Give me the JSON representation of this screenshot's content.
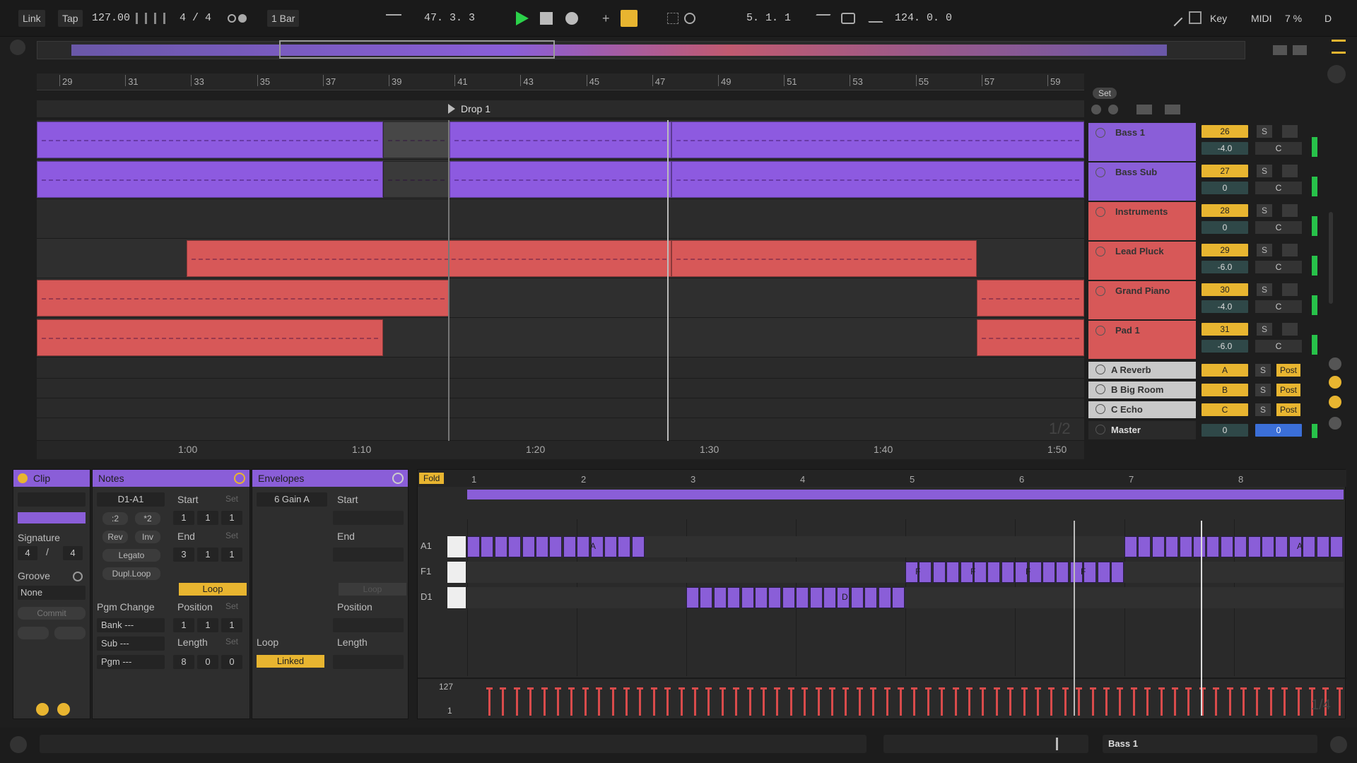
{
  "transport": {
    "link": "Link",
    "tap": "Tap",
    "tempo": "127.00",
    "signature_num": "4",
    "signature_sep": "/",
    "signature_den": "4",
    "quantize": "1 Bar",
    "position": "47.  3.  3",
    "loop_start": "5.  1.  1",
    "loop_length": "124.  0.  0",
    "key": "Key",
    "midi": "MIDI",
    "cpu": "7 %",
    "disk": "D"
  },
  "arrangement": {
    "bars": [
      "29",
      "31",
      "33",
      "35",
      "37",
      "39",
      "41",
      "43",
      "45",
      "47",
      "49",
      "51",
      "53",
      "55",
      "57",
      "59"
    ],
    "locator": "Drop 1",
    "times": [
      "1:00",
      "1:10",
      "1:20",
      "1:30",
      "1:40",
      "1:50"
    ],
    "page_indicator": "1/2",
    "set_label": "Set"
  },
  "tracks": [
    {
      "name": "Bass 1",
      "num": "26",
      "vol": "-4.0",
      "pan": "C",
      "color": "#8a5ed8",
      "solo": "S"
    },
    {
      "name": "Bass Sub",
      "num": "27",
      "vol": "0",
      "pan": "C",
      "color": "#8a5ed8",
      "solo": "S"
    },
    {
      "name": "Instruments",
      "num": "28",
      "vol": "0",
      "pan": "C",
      "color": "#d75858",
      "solo": "S"
    },
    {
      "name": "Lead Pluck",
      "num": "29",
      "vol": "-6.0",
      "pan": "C",
      "color": "#d75858",
      "solo": "S"
    },
    {
      "name": "Grand Piano",
      "num": "30",
      "vol": "-4.0",
      "pan": "C",
      "color": "#d75858",
      "solo": "S"
    },
    {
      "name": "Pad 1",
      "num": "31",
      "vol": "-6.0",
      "pan": "C",
      "color": "#d75858",
      "solo": "S"
    }
  ],
  "returns": [
    {
      "name": "A Reverb",
      "letter": "A",
      "solo": "S",
      "post": "Post"
    },
    {
      "name": "B Big Room",
      "letter": "B",
      "solo": "S",
      "post": "Post"
    },
    {
      "name": "C Echo",
      "letter": "C",
      "solo": "S",
      "post": "Post"
    }
  ],
  "master": {
    "name": "Master",
    "vol": "0",
    "pan": "0"
  },
  "clip_panel": {
    "title": "Clip",
    "signature_label": "Signature",
    "sig_num": "4",
    "sig_sep": "/",
    "sig_den": "4",
    "groove_label": "Groove",
    "groove_value": "None",
    "commit": "Commit"
  },
  "notes_panel": {
    "title": "Notes",
    "range": "D1-A1",
    "start_label": "Start",
    "set": "Set",
    "start": [
      "1",
      "1",
      "1"
    ],
    "div2": ":2",
    "mul2": "*2",
    "rev": "Rev",
    "inv": "Inv",
    "end_label": "End",
    "end": [
      "3",
      "1",
      "1"
    ],
    "legato": "Legato",
    "dupl_loop": "Dupl.Loop",
    "loop": "Loop",
    "pgm_change": "Pgm Change",
    "position_label": "Position",
    "position": [
      "1",
      "1",
      "1"
    ],
    "bank": "Bank ---",
    "sub": "Sub ---",
    "pgm": "Pgm ---",
    "length_label": "Length",
    "length": [
      "8",
      "0",
      "0"
    ]
  },
  "envelopes_panel": {
    "title": "Envelopes",
    "target": "6 Gain A",
    "start_label": "Start",
    "end_label": "End",
    "loop": "Loop",
    "position_label": "Position",
    "loop_label": "Loop",
    "linked": "Linked",
    "length_label": "Length"
  },
  "midi_editor": {
    "fold": "Fold",
    "bars": [
      "1",
      "2",
      "3",
      "4",
      "5",
      "6",
      "7",
      "8"
    ],
    "keys": [
      "A1",
      "F1",
      "D1"
    ],
    "vel_max": "127",
    "vel_min": "1",
    "page": "1/4",
    "note_letters": [
      "A",
      "F",
      "D"
    ]
  },
  "footer": {
    "selected_track": "Bass 1"
  },
  "colors": {
    "purple": "#8a5ed8",
    "red": "#d75858",
    "accent": "#e8b530",
    "play": "#2bd14a"
  }
}
